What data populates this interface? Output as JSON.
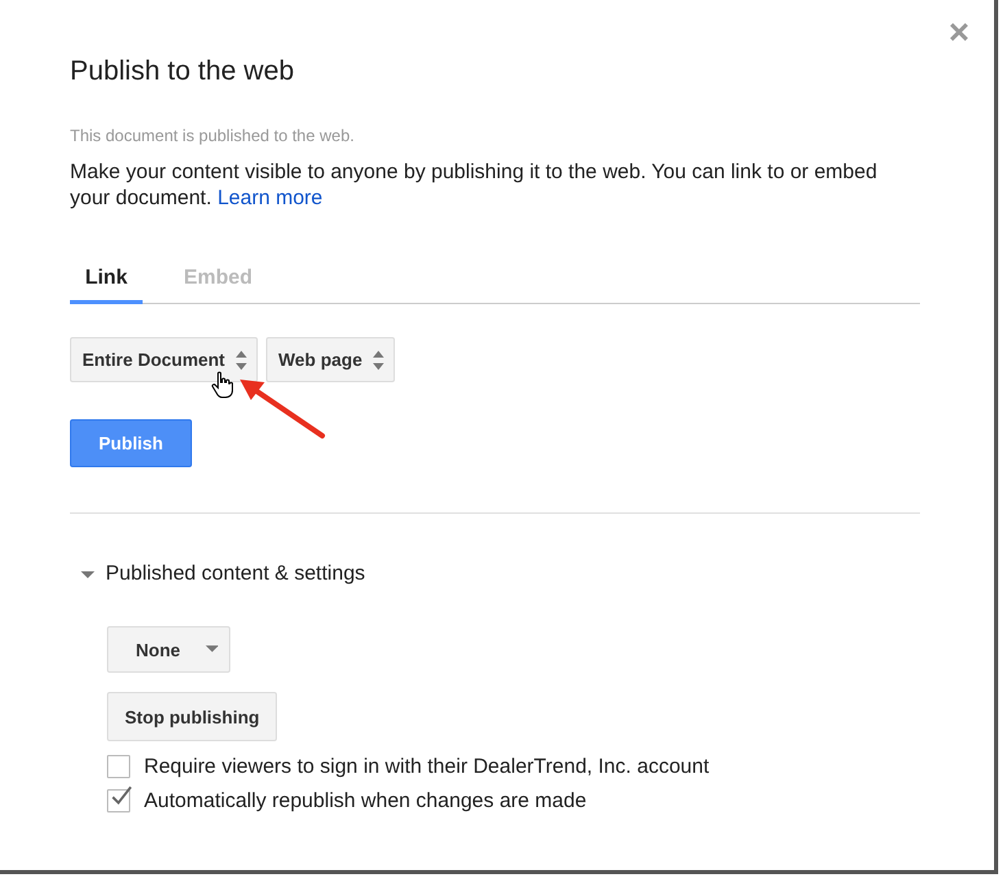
{
  "dialog": {
    "title": "Publish to the web",
    "close": "×"
  },
  "status": "This document is published to the web.",
  "description": {
    "text": "Make your content visible to anyone by publishing it to the web. You can link to or embed your document.",
    "link": "Learn more"
  },
  "tabs": [
    {
      "label": "Link",
      "selected": true
    },
    {
      "label": "Embed",
      "selected": false
    }
  ],
  "selects": [
    "Entire Document",
    "Web page"
  ],
  "publish_button": "Publish",
  "section": {
    "title": "Published content & settings",
    "expanded": true,
    "dropdown": "None",
    "stop_button": "Stop publishing",
    "options": [
      {
        "label": "Require viewers to sign in with their DealerTrend, Inc. account",
        "checked": false
      },
      {
        "label": "Automatically republish when changes are made",
        "checked": true
      }
    ]
  }
}
